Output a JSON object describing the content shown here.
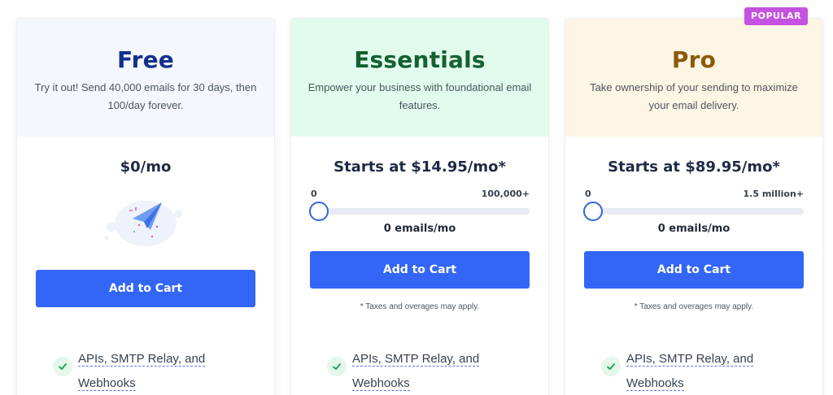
{
  "popular_badge": "POPULAR",
  "colors": {
    "button": "#3366f6",
    "badge": "#c552e0",
    "free_header_bg": "#f4f7fd",
    "essentials_header_bg": "#e1fbec",
    "pro_header_bg": "#fdf6e4",
    "free_title": "#14308e",
    "essentials_title": "#136130",
    "pro_title": "#8a5a0b"
  },
  "plans": [
    {
      "name": "Free",
      "description": "Try it out! Send 40,000 emails for 30 days, then 100/day forever.",
      "price": "$0/mo",
      "illustration_icon": "paper-plane-icon",
      "cta": "Add to Cart",
      "feature": "APIs, SMTP Relay, and Webhooks"
    },
    {
      "name": "Essentials",
      "description": "Empower your business with foundational email features.",
      "price": "Starts at $14.95/mo*",
      "slider": {
        "min_label": "0",
        "max_label": "100,000+",
        "value_fraction": 0
      },
      "emails_readout": "0 emails/mo",
      "cta": "Add to Cart",
      "note": "* Taxes and overages may apply.",
      "feature": "APIs, SMTP Relay, and Webhooks"
    },
    {
      "name": "Pro",
      "description": "Take ownership of your sending to maximize your email delivery.",
      "price": "Starts at $89.95/mo*",
      "slider": {
        "min_label": "0",
        "max_label": "1.5 million+",
        "value_fraction": 0
      },
      "emails_readout": "0 emails/mo",
      "cta": "Add to Cart",
      "note": "* Taxes and overages may apply.",
      "feature": "APIs, SMTP Relay, and Webhooks"
    }
  ]
}
